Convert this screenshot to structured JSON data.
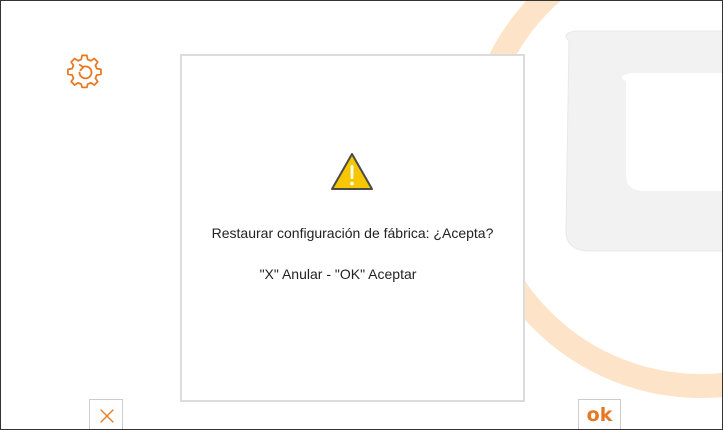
{
  "dialog": {
    "message": "Restaurar configuración de fábrica: ¿Acepta?",
    "hint": "\"X\" Anular - \"OK\" Aceptar"
  },
  "buttons": {
    "ok_label": "ok"
  },
  "icons": {
    "settings": "settings-restore-icon",
    "warning": "warning-icon",
    "cancel": "close-icon",
    "watermark": "brand-logo-watermark"
  },
  "colors": {
    "accent": "#e87722",
    "watermark_stroke": "#fde3c8",
    "watermark_fill": "#f2f2f2",
    "warning_fill": "#f6c700",
    "dialog_border": "#dcdcdc"
  }
}
